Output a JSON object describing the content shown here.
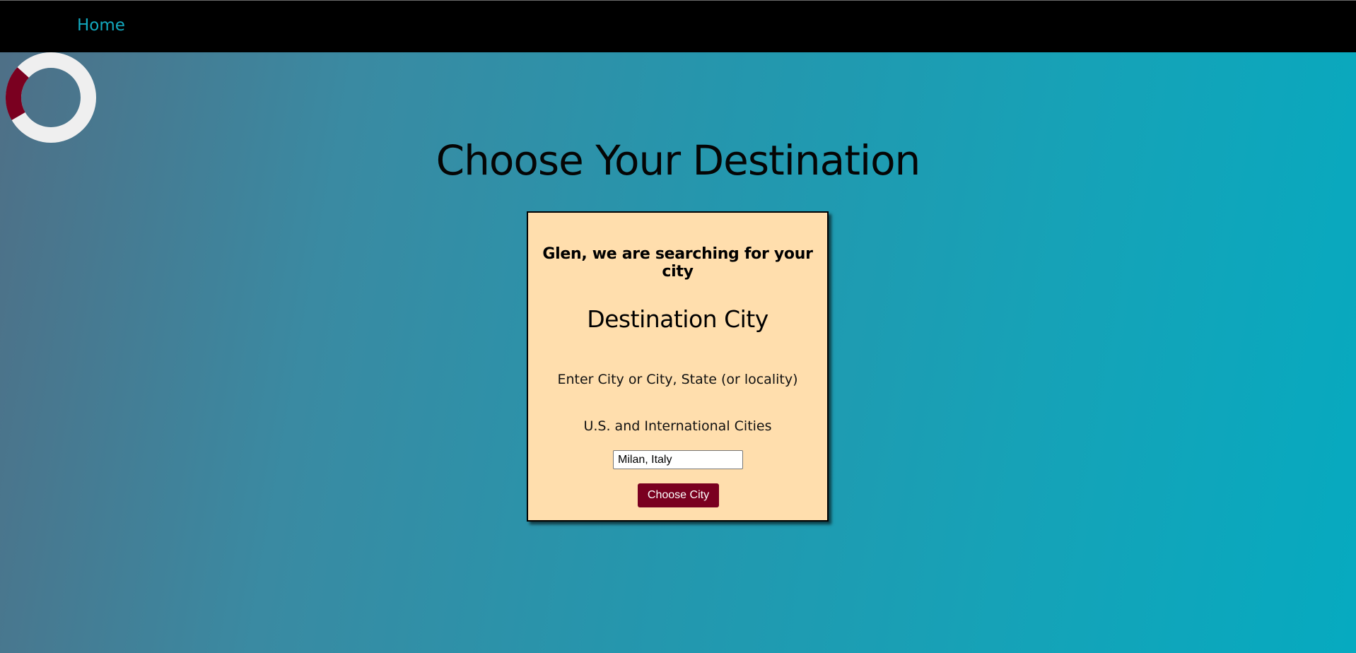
{
  "nav": {
    "home_label": "Home"
  },
  "page": {
    "title": "Choose Your Destination"
  },
  "card": {
    "greeting": "Glen, we are searching for your city",
    "heading": "Destination City",
    "instruction": "Enter City or City, State (or locality)",
    "subtext": "U.S. and International Cities",
    "city_input_value": "Milan, Italy",
    "button_label": "Choose City"
  },
  "spinner": {
    "icon": "loading-spinner-icon",
    "progress_fraction": 0.2
  },
  "colors": {
    "navbar_bg": "#000000",
    "nav_link": "#13a9bf",
    "card_bg": "#ffdead",
    "button_bg": "#7a0020",
    "spinner_track": "#efefef",
    "spinner_arc": "#7a0020"
  }
}
